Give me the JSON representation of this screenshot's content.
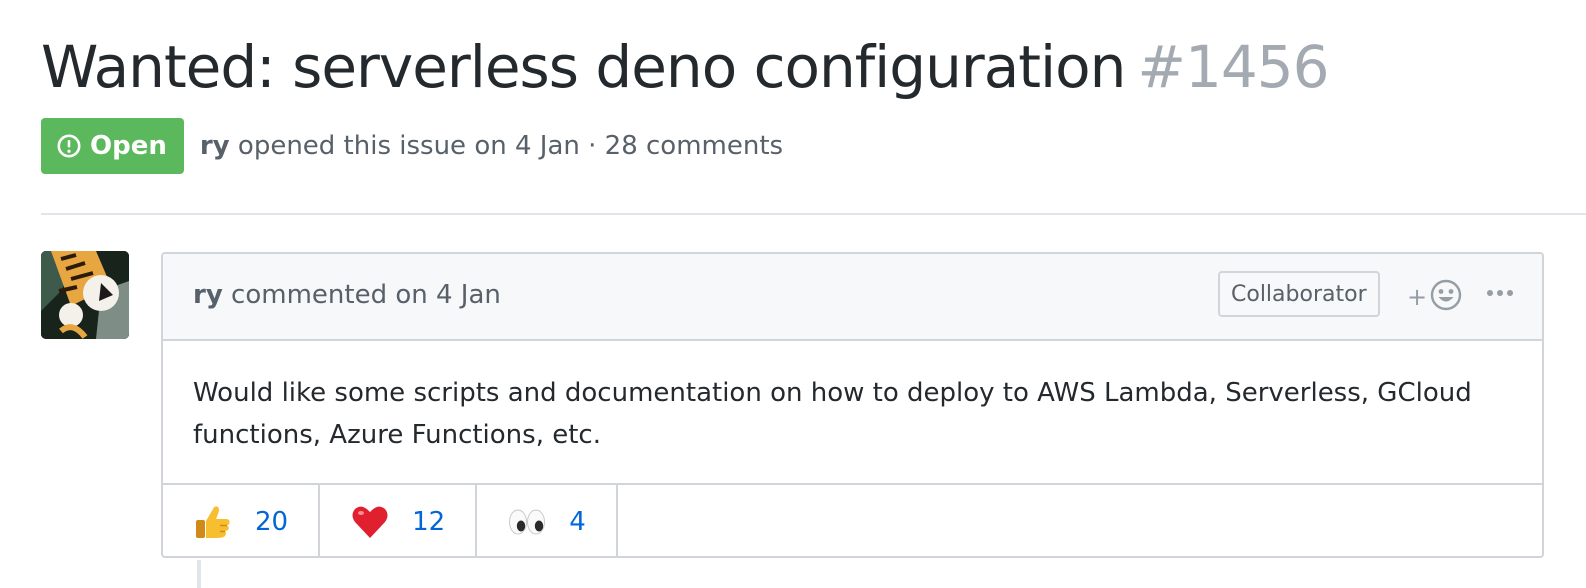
{
  "issue": {
    "title": "Wanted: serverless deno configuration",
    "number": "#1456",
    "state": "Open",
    "author": "ry",
    "meta_suffix": "opened this issue on 4 Jan · 28 comments",
    "state_color": "#5cb85c"
  },
  "comment": {
    "author": "ry",
    "header_suffix": "commented on 4 Jan",
    "role": "Collaborator",
    "add_reaction_label": "+",
    "body": "Would like some scripts and documentation on how to deploy to AWS Lambda, Serverless, GCloud functions, Azure Functions, etc.",
    "reactions": [
      {
        "icon": "thumbs-up-icon",
        "count": "20"
      },
      {
        "icon": "heart-icon",
        "count": "12"
      },
      {
        "icon": "eyes-icon",
        "count": "4"
      }
    ]
  },
  "colors": {
    "link": "#0366d6",
    "muted": "#586069",
    "border": "#d1d5da"
  }
}
